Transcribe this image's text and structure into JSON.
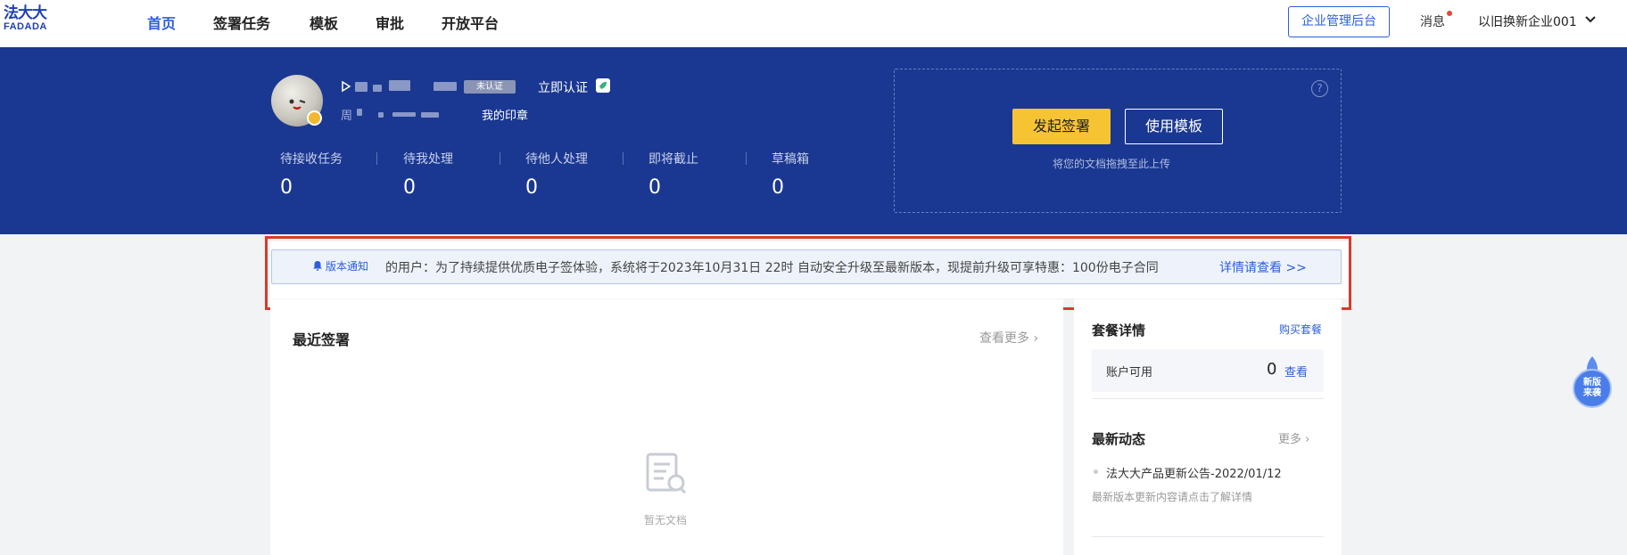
{
  "nav": {
    "logo_cn": "法大大",
    "logo_en": "FADADA",
    "items": [
      {
        "label": "首页",
        "active": true
      },
      {
        "label": "签署任务",
        "active": false
      },
      {
        "label": "模板",
        "active": false
      },
      {
        "label": "审批",
        "active": false
      },
      {
        "label": "开放平台",
        "active": false
      }
    ],
    "admin_button": "企业管理后台",
    "messages": "消息",
    "company": "以旧换新企业001"
  },
  "profile": {
    "uncertified_tag": "未认证",
    "certify_link": "立即认证",
    "name_prefix": "周",
    "my_seal": "我的印章"
  },
  "stats": [
    {
      "label": "待接收任务",
      "value": "0"
    },
    {
      "label": "待我处理",
      "value": "0"
    },
    {
      "label": "待他人处理",
      "value": "0"
    },
    {
      "label": "即将截止",
      "value": "0"
    },
    {
      "label": "草稿箱",
      "value": "0"
    }
  ],
  "upload": {
    "help": "?",
    "start_sign": "发起签署",
    "use_template": "使用模板",
    "hint": "将您的文档拖拽至此上传"
  },
  "notice": {
    "tag": "版本通知",
    "text": "的用户：为了持续提供优质电子签体验，系统将于2023年10月31日 22时 自动安全升级至最新版本，现提前升级可享特惠：100份电子合同",
    "link": "详情请查看 >>"
  },
  "recent": {
    "title": "最近签署",
    "more": "查看更多 ›",
    "empty": "暂无文档"
  },
  "package": {
    "title": "套餐详情",
    "buy": "购买套餐",
    "account_label": "账户可用",
    "account_value": "0",
    "view": "查看"
  },
  "news": {
    "title": "最新动态",
    "more": "更多 ›",
    "item": "法大大产品更新公告-2022/01/12",
    "sub": "最新版本更新内容请点击了解详情"
  },
  "float_badge": "新版来袭",
  "colors": {
    "brand_blue": "#1a3891",
    "link_blue": "#2b5fd9",
    "primary_yellow": "#f6c432",
    "highlight_red": "#d83a2a"
  }
}
